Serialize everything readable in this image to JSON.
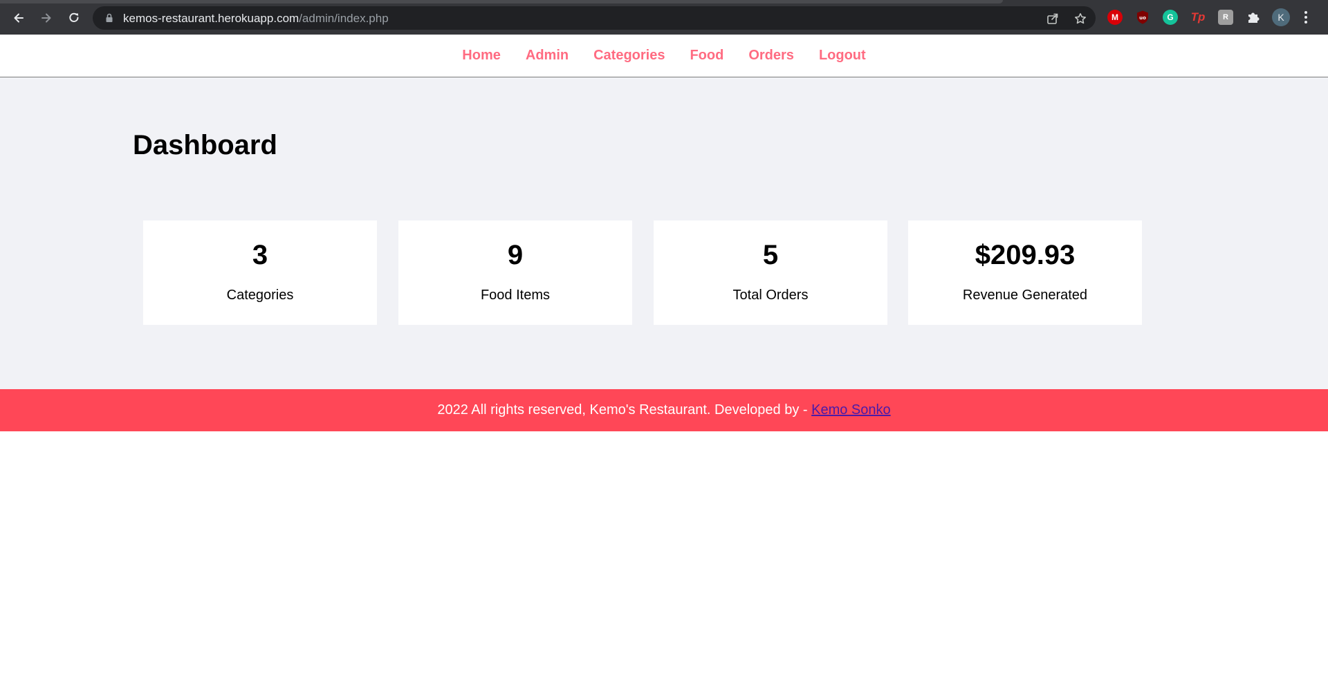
{
  "browser": {
    "url_host": "kemos-restaurant.herokuapp.com",
    "url_path": "/admin/index.php",
    "profile_initial": "K",
    "extensions": [
      {
        "name": "mega-extension-icon",
        "color": "#d90007"
      },
      {
        "name": "ublock-origin-icon",
        "color": "#800000"
      },
      {
        "name": "grammarly-icon",
        "color": "#15c39a"
      },
      {
        "name": "tp-extension-icon",
        "color": "#e53935"
      },
      {
        "name": "reader-extension-icon",
        "color": "#9e9e9e"
      },
      {
        "name": "extensions-puzzle-icon",
        "color": "#e8eaed"
      }
    ]
  },
  "nav": {
    "items": [
      "Home",
      "Admin",
      "Categories",
      "Food",
      "Orders",
      "Logout"
    ]
  },
  "dashboard": {
    "title": "Dashboard",
    "cards": [
      {
        "value": "3",
        "label": "Categories"
      },
      {
        "value": "9",
        "label": "Food Items"
      },
      {
        "value": "5",
        "label": "Total Orders"
      },
      {
        "value": "$209.93",
        "label": "Revenue Generated"
      }
    ]
  },
  "footer": {
    "text": "2022 All rights reserved, Kemo's Restaurant. Developed by - ",
    "link_text": "Kemo Sonko"
  },
  "colors": {
    "nav_link": "#ff6b81",
    "main_bg": "#f1f2f6",
    "footer_bg": "#ff4757"
  }
}
